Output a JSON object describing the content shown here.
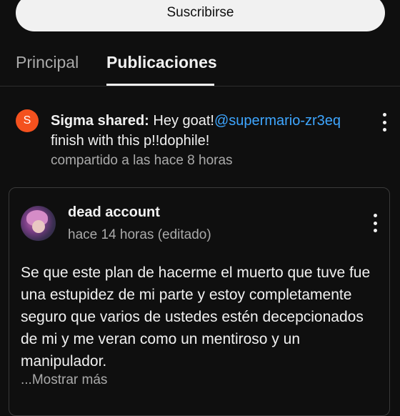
{
  "subscribe": {
    "label": "Suscribirse"
  },
  "tabs": [
    {
      "label": "Principal",
      "active": false
    },
    {
      "label": "Publicaciones",
      "active": true
    }
  ],
  "shared_post": {
    "avatar_letter": "S",
    "avatar_color": "#f4511e",
    "author": "Sigma shared:",
    "text_start": " Hey goat!",
    "mention": "@supermario-zr3eq",
    "text_end": " finish with this p!!dophile!",
    "time": "compartido a las hace 8 horas",
    "menu_icon": "more-vert-icon"
  },
  "post": {
    "author": "dead account",
    "time": "hace 14 horas (editado)",
    "body": "Se que este plan de hacerme el muerto que tuve fue una estupidez de mi parte y estoy completamente seguro que varios de ustedes estén decepcionados de mi y me veran como un mentiroso y un manipulador.",
    "show_more": "...Mostrar más",
    "menu_icon": "more-vert-icon"
  },
  "colors": {
    "background": "#0f0f0f",
    "link": "#3ea6ff",
    "secondary_text": "#aaaaaa"
  }
}
